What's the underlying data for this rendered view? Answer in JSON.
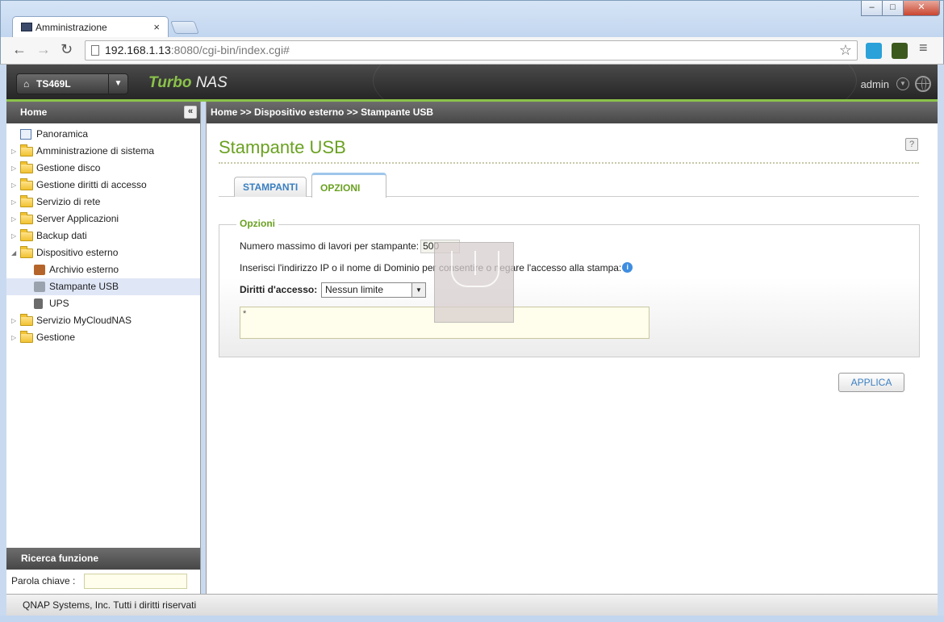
{
  "browser": {
    "tab_title": "Amministrazione",
    "tab_close": "×",
    "url_host": "192.168.1.13",
    "url_rest": ":8080/cgi-bin/index.cgi#"
  },
  "header": {
    "device": "TS469L",
    "brand_turbo": "Turbo",
    "brand_nas": "NAS",
    "user": "admin"
  },
  "sidebar": {
    "title": "Home",
    "items": [
      {
        "label": "Panoramica"
      },
      {
        "label": "Amministrazione di sistema"
      },
      {
        "label": "Gestione disco"
      },
      {
        "label": "Gestione diritti di accesso"
      },
      {
        "label": "Servizio di rete"
      },
      {
        "label": "Server Applicazioni"
      },
      {
        "label": "Backup dati"
      },
      {
        "label": "Dispositivo esterno"
      },
      {
        "label": "Archivio esterno"
      },
      {
        "label": "Stampante USB"
      },
      {
        "label": "UPS"
      },
      {
        "label": "Servizio MyCloudNAS"
      },
      {
        "label": "Gestione"
      }
    ],
    "search_title": "Ricerca funzione",
    "search_label": "Parola chiave :"
  },
  "main": {
    "breadcrumb": "Home >> Dispositivo esterno >> Stampante USB",
    "title": "Stampante USB",
    "tabs": [
      {
        "label": "STAMPANTI"
      },
      {
        "label": "OPZIONI"
      }
    ],
    "options": {
      "legend": "Opzioni",
      "max_jobs_label": "Numero massimo di lavori per stampante:",
      "max_jobs_value": "500",
      "ip_note": "Inserisci l'indirizzo IP o il nome di Dominio per consentire o negare l'accesso alla stampa:",
      "access_label": "Diritti d'accesso:",
      "access_value": "Nessun limite",
      "list_value": "*"
    },
    "apply_label": "APPLICA"
  },
  "footer": {
    "text": "QNAP Systems, Inc. Tutti i diritti riservati"
  }
}
